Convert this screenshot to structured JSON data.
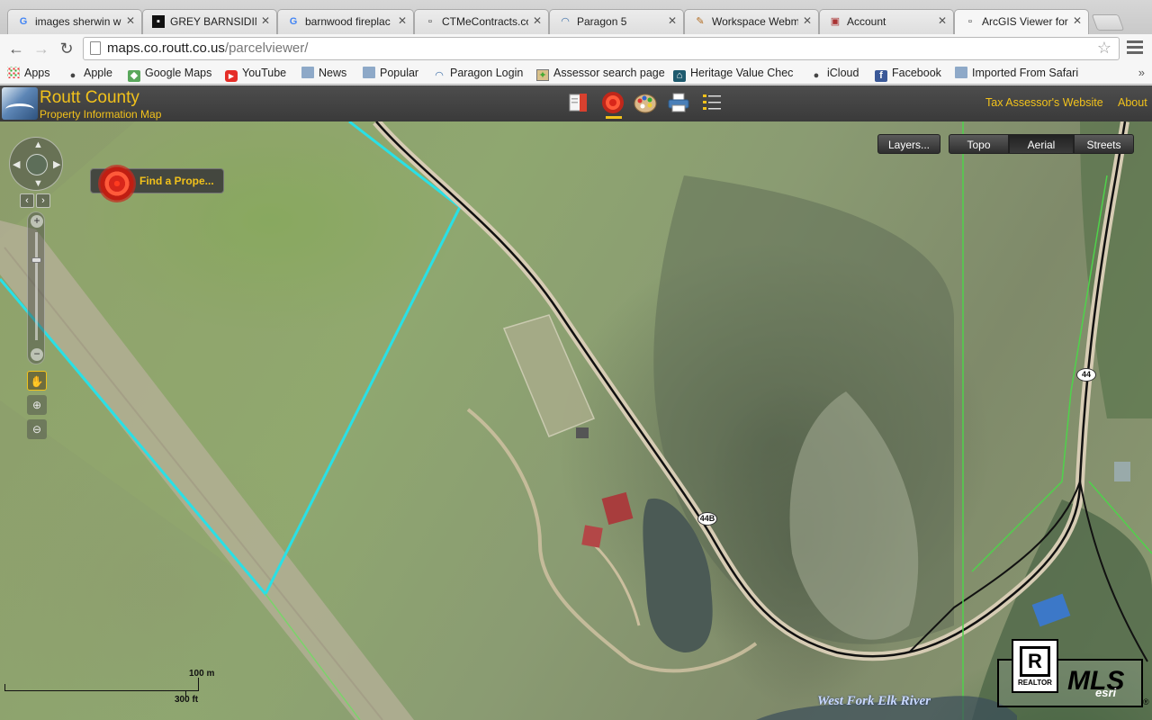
{
  "browser": {
    "tabs": [
      {
        "label": "images sherwin w",
        "icon": "G"
      },
      {
        "label": "GREY BARNSIDING",
        "icon": "▪"
      },
      {
        "label": "barnwood fireplac",
        "icon": "G"
      },
      {
        "label": "CTMeContracts.co",
        "icon": "▫"
      },
      {
        "label": "Paragon 5",
        "icon": "◠"
      },
      {
        "label": "Workspace Webm",
        "icon": "✎"
      },
      {
        "label": "Account",
        "icon": "▣"
      },
      {
        "label": "ArcGIS Viewer for",
        "icon": "▫"
      }
    ],
    "url_host": "maps.co.routt.co.us",
    "url_path": "/parcelviewer/",
    "bookmarks": [
      {
        "label": "Apps",
        "icon": "apps-grid-icon"
      },
      {
        "label": "Apple",
        "icon": "apple-icon"
      },
      {
        "label": "Google Maps",
        "icon": "google-maps-icon"
      },
      {
        "label": "YouTube",
        "icon": "youtube-icon"
      },
      {
        "label": "News",
        "icon": "folder-icon"
      },
      {
        "label": "Popular",
        "icon": "folder-icon"
      },
      {
        "label": "Paragon Login",
        "icon": "paragon-icon"
      },
      {
        "label": "Assessor search page",
        "icon": "assessor-icon"
      },
      {
        "label": "Heritage Value Chec",
        "icon": "heritage-icon"
      },
      {
        "label": "iCloud",
        "icon": "apple-icon"
      },
      {
        "label": "Facebook",
        "icon": "facebook-icon"
      },
      {
        "label": "Imported From Safari",
        "icon": "folder-icon"
      }
    ]
  },
  "app": {
    "title": "Routt County",
    "subtitle": "Property Information Map",
    "links": {
      "tax": "Tax Assessor's Website",
      "about": "About"
    },
    "accent": "#f2c21b"
  },
  "map": {
    "find_property": "Find a Prope...",
    "layers": "Layers...",
    "basemaps": [
      "Topo",
      "Aerial",
      "Streets"
    ],
    "selected_basemap": "Aerial",
    "scale": {
      "metric": "100 m",
      "imperial": "300 ft"
    },
    "river_label": "West Fork Elk River",
    "road_labels": [
      "44B",
      "44"
    ],
    "realtor_label": "REALTOR",
    "mls_label": "MLS",
    "esri_label": "esri",
    "reg_mark": "®"
  }
}
